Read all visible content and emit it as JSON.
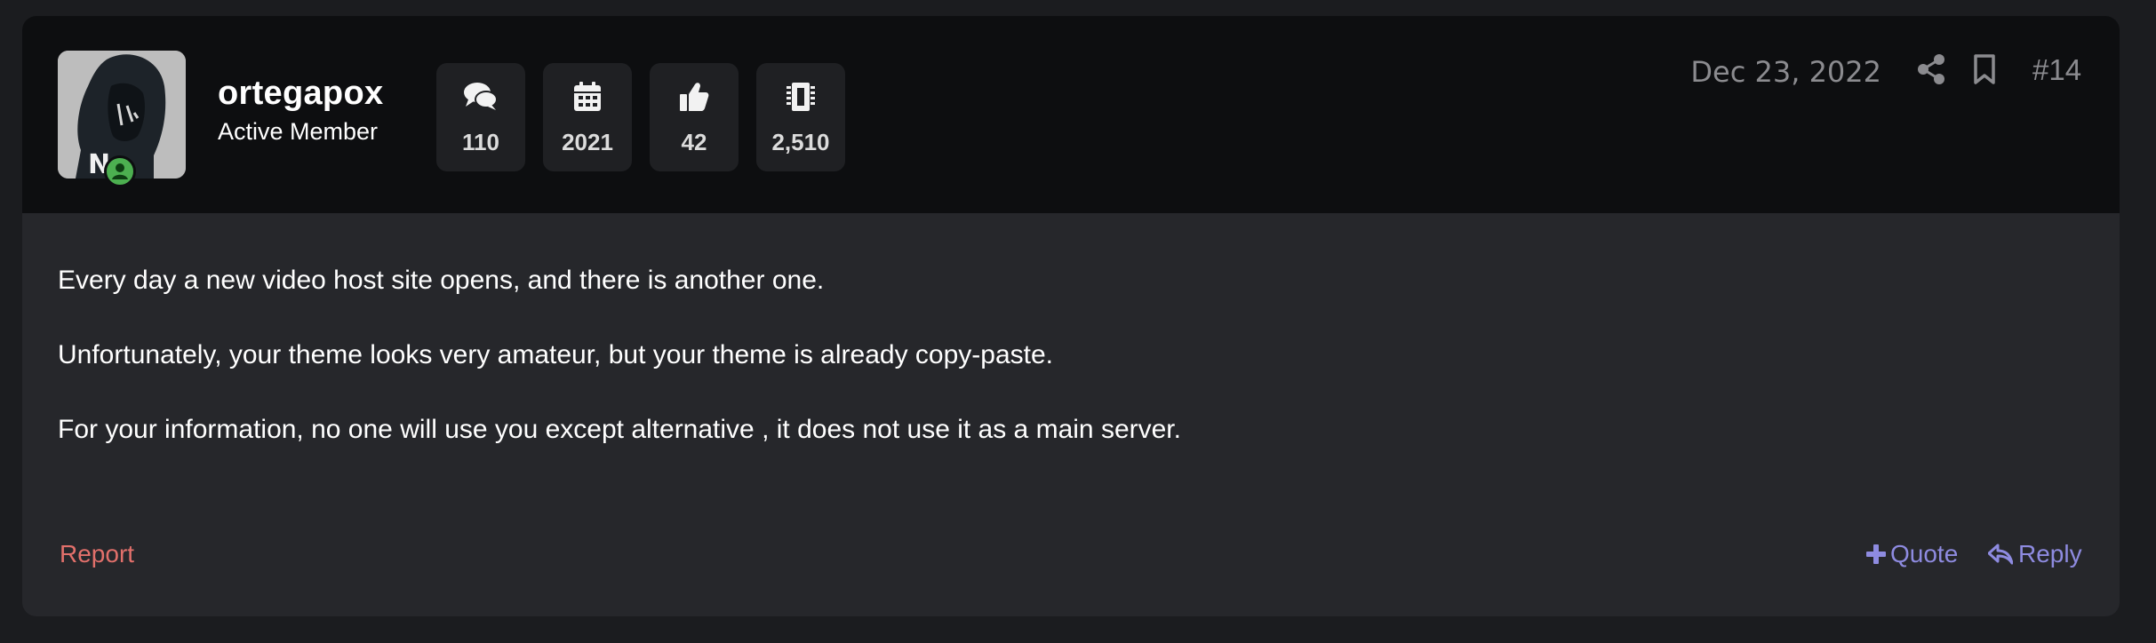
{
  "post": {
    "user": {
      "avatar": "avatar-photo",
      "username": "ortegapox",
      "title": "Active Member",
      "status_icon": "online-user-icon"
    },
    "stats": [
      {
        "icon": "comments-icon",
        "value": "110"
      },
      {
        "icon": "calendar-icon",
        "value": "2021"
      },
      {
        "icon": "thumbs-up-icon",
        "value": "42"
      },
      {
        "icon": "memory-chip-icon",
        "value": "2,510"
      }
    ],
    "date": "Dec 23, 2022",
    "number": "#14",
    "body": [
      "Every day a new video host site opens, and there is another one.",
      "Unfortunately, your theme looks very amateur, but your theme is already copy-paste.",
      "For your information, no one will use you except alternative , it does not use it as a main server."
    ],
    "actions": {
      "report": "Report",
      "quote": "Quote",
      "reply": "Reply"
    }
  },
  "colors": {
    "page_bg": "#1b1c1f",
    "card_bg": "#26272b",
    "header_bg": "#0d0e10",
    "report": "#e2706b",
    "action": "#8e8be0",
    "online": "#4caf50"
  }
}
